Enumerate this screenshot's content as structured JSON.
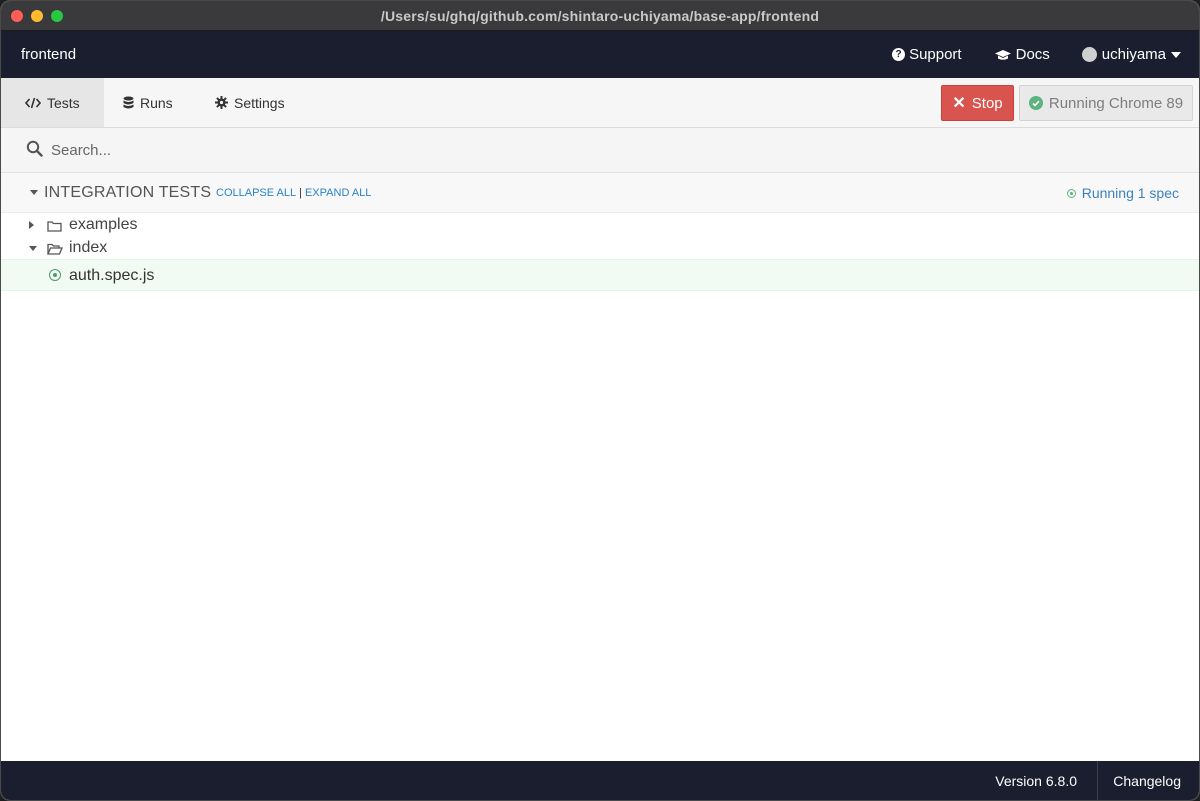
{
  "window": {
    "title": "/Users/su/ghq/github.com/shintaro-uchiyama/base-app/frontend"
  },
  "header": {
    "project": "frontend",
    "support_label": "Support",
    "docs_label": "Docs",
    "user_label": "uchiyama"
  },
  "nav": {
    "tabs": [
      {
        "label": "Tests",
        "icon": "code-icon",
        "active": true
      },
      {
        "label": "Runs",
        "icon": "database-icon",
        "active": false
      },
      {
        "label": "Settings",
        "icon": "gear-icon",
        "active": false
      }
    ],
    "stop_label": "Stop",
    "browser_status": "Running Chrome 89"
  },
  "search": {
    "placeholder": "Search..."
  },
  "section": {
    "title": "INTEGRATION TESTS",
    "collapse_all": "COLLAPSE ALL",
    "separator": "|",
    "expand_all": "EXPAND ALL",
    "status": "Running 1 spec"
  },
  "tree": [
    {
      "type": "folder",
      "name": "examples",
      "expanded": false
    },
    {
      "type": "folder",
      "name": "index",
      "expanded": true
    },
    {
      "type": "spec",
      "name": "auth.spec.js",
      "running": true
    }
  ],
  "footer": {
    "version": "Version 6.8.0",
    "changelog": "Changelog"
  },
  "colors": {
    "header_bg": "#1b1e2e",
    "stop_red": "#d9534f",
    "running_green": "#5cb37d",
    "link_blue": "#2a83c7"
  }
}
